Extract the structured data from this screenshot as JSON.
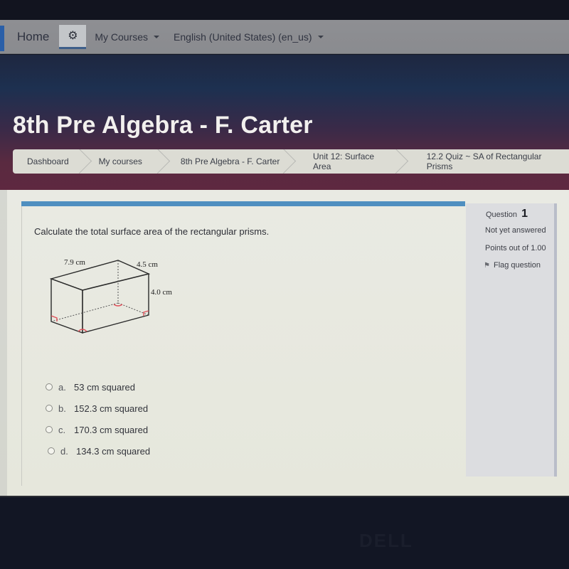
{
  "navbar": {
    "home_label": "Home",
    "settings_icon": "gears-icon",
    "my_courses_label": "My Courses",
    "language_label": "English (United States) (en_us)"
  },
  "header": {
    "course_title": "8th Pre Algebra - F. Carter"
  },
  "breadcrumb": [
    {
      "label": "Dashboard"
    },
    {
      "label": "My courses"
    },
    {
      "label": "8th Pre Algebra - F. Carter"
    },
    {
      "label": "Unit 12: Surface Area"
    },
    {
      "label": "12.2 Quiz ~ SA of Rectangular Prisms"
    }
  ],
  "question_info": {
    "question_label": "Question",
    "question_number": "1",
    "state": "Not yet answered",
    "grade": "Points out of 1.00",
    "flag_label": "Flag question"
  },
  "question": {
    "text": "Calculate the total surface area of the rectangular prisms.",
    "figure": {
      "length_label": "7.9 cm",
      "width_label": "4.5 cm",
      "height_label": "4.0 cm",
      "right_angle_color": "#e0505a"
    },
    "answers": [
      {
        "letter": "a.",
        "text": "53 cm squared",
        "selected": false
      },
      {
        "letter": "b.",
        "text": "152.3 cm squared",
        "selected": false
      },
      {
        "letter": "c.",
        "text": "170.3 cm squared",
        "selected": false
      },
      {
        "letter": "d.",
        "text": "134.3 cm squared",
        "selected": false
      }
    ]
  },
  "colors": {
    "accent_bar": "#4f8fc0",
    "header_gradient_end": "#5e2840"
  },
  "monitor": {
    "brand": "DELL"
  }
}
